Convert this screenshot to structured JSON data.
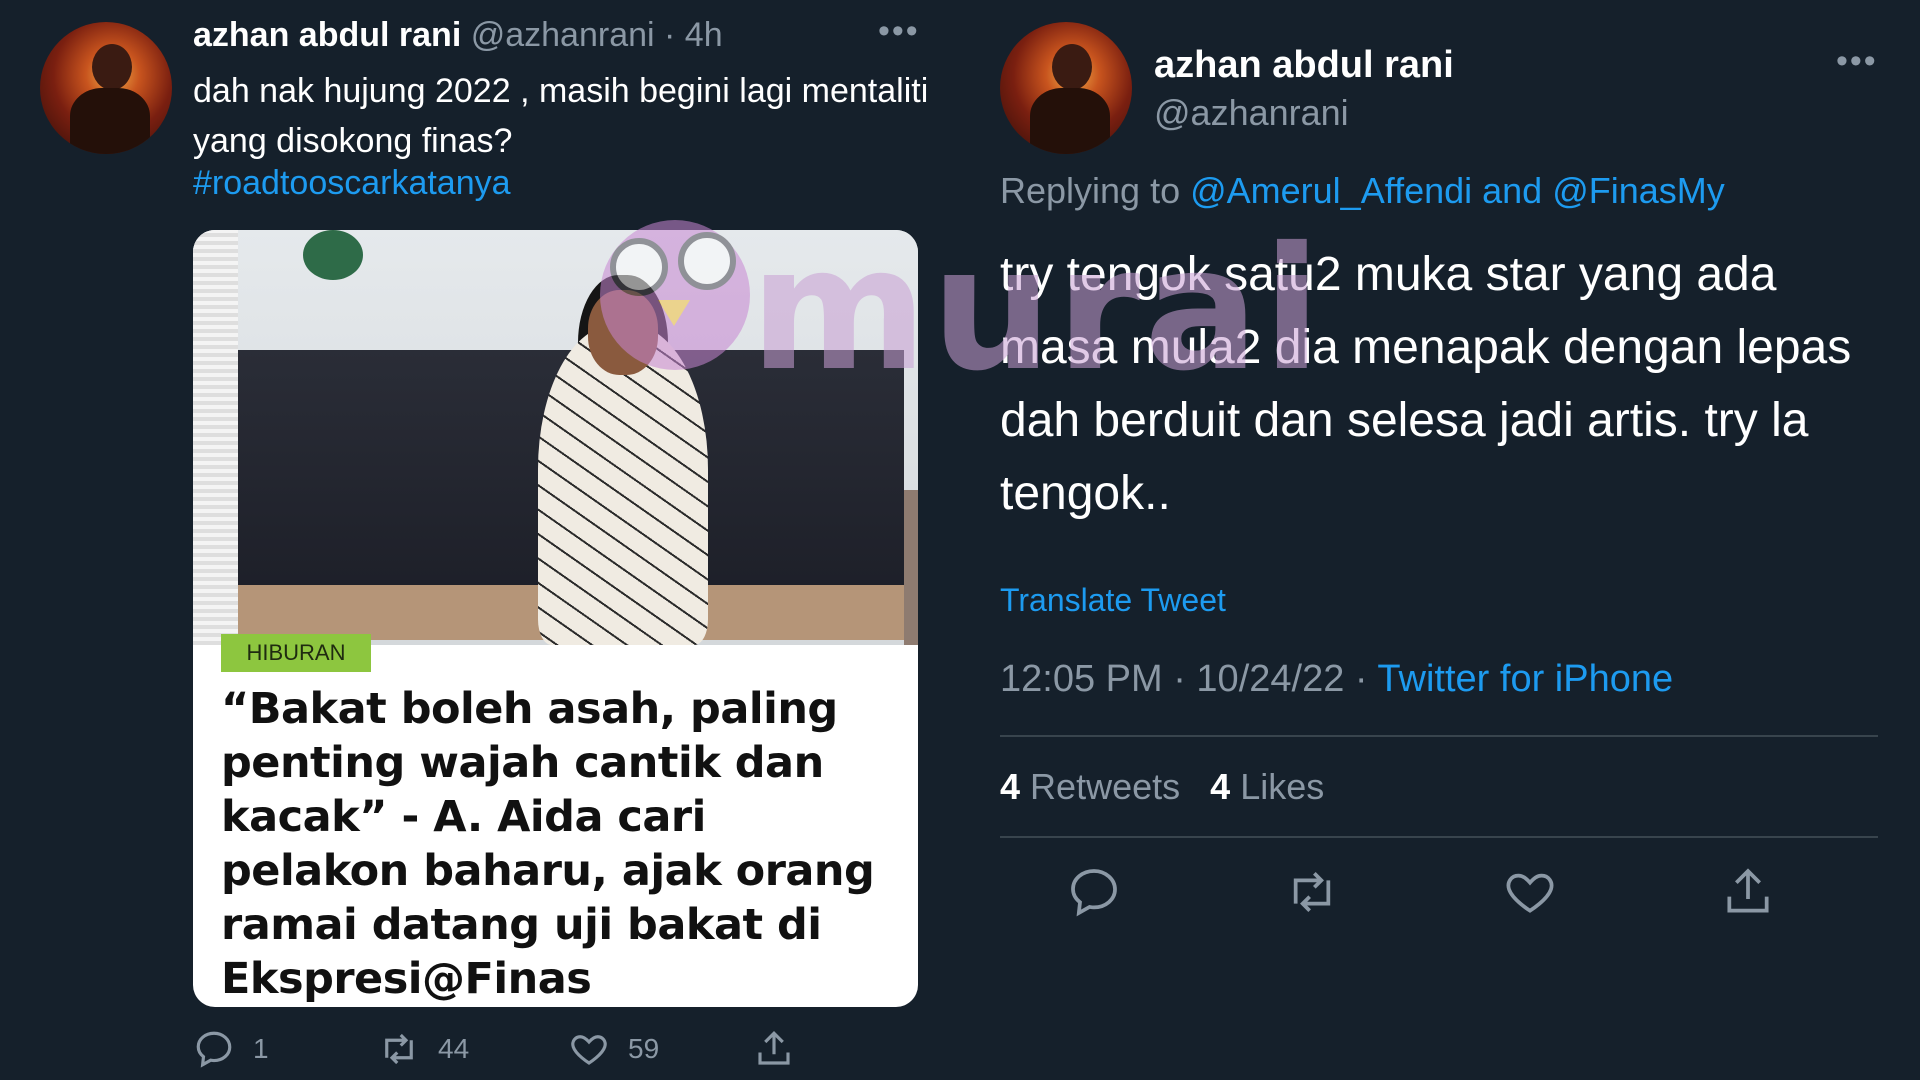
{
  "left_tweet": {
    "name": "azhan abdul rani",
    "handle_time": "@azhanrani · 4h",
    "more": "•••",
    "text": "dah nak hujung 2022 , masih begini lagi mentaliti yang disokong finas?",
    "hashtag": "#roadtooscarkatanya",
    "card": {
      "badge": "HIBURAN",
      "headline": "“Bakat boleh asah, paling penting wajah cantik dan kacak” - A. Aida cari pelakon baharu, ajak orang ramai datang uji bakat di Ekspresi@Finas"
    },
    "actions": {
      "reply_count": "1",
      "retweet_count": "44",
      "like_count": "59"
    }
  },
  "right_tweet": {
    "name": "azhan abdul rani",
    "handle": "@azhanrani",
    "more": "•••",
    "replying_prefix": "Replying to ",
    "replying_mentions": "@Amerul_Affendi and @FinasMy",
    "text": "try tengok satu2 muka star yang ada masa mula2 dia menapak dengan lepas dah berduit dan selesa jadi artis. try la tengok..",
    "translate": "Translate Tweet",
    "timestamp": "12:05 PM · 10/24/22 · ",
    "source": "Twitter for iPhone",
    "retweets_count": "4",
    "retweets_label": "Retweets",
    "likes_count": "4",
    "likes_label": "Likes"
  },
  "watermark": {
    "text": "murai"
  },
  "colors": {
    "background": "#15202b",
    "accent": "#1d9bf0",
    "muted": "#8b98a5",
    "badge": "#8dc63f"
  }
}
